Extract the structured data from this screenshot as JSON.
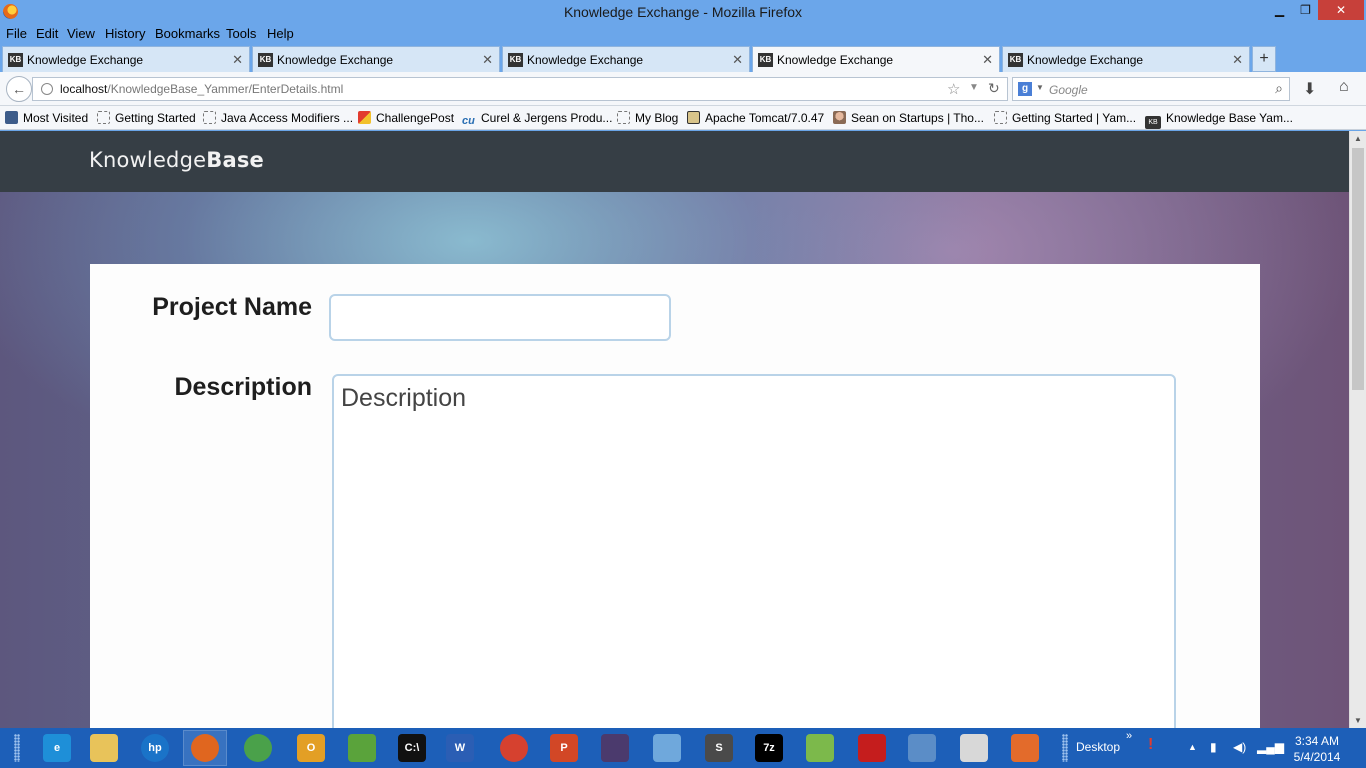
{
  "window": {
    "title": "Knowledge Exchange - Mozilla Firefox",
    "minimize_glyph": "▁",
    "maximize_glyph": "❐",
    "close_glyph": "✕"
  },
  "menu": [
    "File",
    "Edit",
    "View",
    "History",
    "Bookmarks",
    "Tools",
    "Help"
  ],
  "tabs": [
    {
      "label": "Knowledge Exchange",
      "favicon": "KB",
      "active": false
    },
    {
      "label": "Knowledge Exchange",
      "favicon": "KB",
      "active": false
    },
    {
      "label": "Knowledge Exchange",
      "favicon": "KB",
      "active": false
    },
    {
      "label": "Knowledge Exchange",
      "favicon": "KB",
      "active": true
    },
    {
      "label": "Knowledge Exchange",
      "favicon": "KB",
      "active": false
    }
  ],
  "tab_close_glyph": "✕",
  "new_tab_glyph": "+",
  "nav": {
    "back_glyph": "←",
    "url_host": "localhost",
    "url_path": "/KnowledgeBase_Yammer/EnterDetails.html",
    "star_glyph": "☆",
    "dropdown_glyph": "▼",
    "reload_glyph": "↻",
    "search_engine": "g",
    "search_placeholder": "Google",
    "search_glyph": "⌕",
    "download_glyph": "⬇",
    "home_glyph": "⌂"
  },
  "bookmarks": [
    {
      "label": "Most Visited",
      "icon": "bookmark-folder-icon"
    },
    {
      "label": "Getting Started",
      "icon": "page-icon"
    },
    {
      "label": "Java Access Modifiers ...",
      "icon": "page-icon"
    },
    {
      "label": "ChallengePost",
      "icon": "challengepost-icon"
    },
    {
      "label": "Curel & Jergens Produ...",
      "icon": "curel-icon"
    },
    {
      "label": "My Blog",
      "icon": "page-icon"
    },
    {
      "label": "Apache Tomcat/7.0.47",
      "icon": "tomcat-icon"
    },
    {
      "label": "Sean on Startups | Tho...",
      "icon": "avatar-icon"
    },
    {
      "label": "Getting Started | Yam...",
      "icon": "page-icon"
    },
    {
      "label": "Knowledge Base Yam...",
      "icon": "kb-icon"
    }
  ],
  "site": {
    "brand_light": "Knowledge",
    "brand_bold": "Base"
  },
  "form": {
    "project_name_label": "Project Name",
    "project_name_value": "",
    "description_label": "Description",
    "description_placeholder": "Description",
    "description_value": ""
  },
  "taskbar": {
    "apps": [
      {
        "name": "internet-explorer-icon",
        "glyph": "e",
        "color": "#1e8fd8"
      },
      {
        "name": "file-explorer-icon",
        "glyph": "",
        "color": "#e8c35a"
      },
      {
        "name": "hp-icon",
        "glyph": "hp",
        "color": "#1a73c8"
      },
      {
        "name": "firefox-icon",
        "glyph": "",
        "color": "#e0661f"
      },
      {
        "name": "chrome-icon",
        "glyph": "",
        "color": "#4aa14a"
      },
      {
        "name": "outlook-icon",
        "glyph": "O",
        "color": "#e39f25"
      },
      {
        "name": "evernote-icon",
        "glyph": "",
        "color": "#5aa33b"
      },
      {
        "name": "command-prompt-icon",
        "glyph": "C:\\",
        "color": "#111111"
      },
      {
        "name": "word-icon",
        "glyph": "W",
        "color": "#2b5eb4"
      },
      {
        "name": "media-player-icon",
        "glyph": "",
        "color": "#d6412f"
      },
      {
        "name": "powerpoint-icon",
        "glyph": "P",
        "color": "#d24726"
      },
      {
        "name": "eclipse-java-ee-icon",
        "glyph": "",
        "color": "#4b3a6d"
      },
      {
        "name": "remote-desktop-icon",
        "glyph": "",
        "color": "#6fa8dc"
      },
      {
        "name": "sublime-text-icon",
        "glyph": "S",
        "color": "#4a4a4a"
      },
      {
        "name": "7zip-icon",
        "glyph": "7z",
        "color": "#000000"
      },
      {
        "name": "notepad-plus-icon",
        "glyph": "",
        "color": "#7cb94b"
      },
      {
        "name": "acrobat-icon",
        "glyph": "",
        "color": "#c51d1d"
      },
      {
        "name": "paint-icon",
        "glyph": "",
        "color": "#5b8dc7"
      },
      {
        "name": "java-icon",
        "glyph": "",
        "color": "#d8d8d8"
      },
      {
        "name": "install-icon",
        "glyph": "",
        "color": "#e36b2b"
      }
    ],
    "desktop_label": "Desktop",
    "more_glyph": "»",
    "up_arrow_glyph": "▲",
    "time": "3:34 AM",
    "date": "5/4/2014"
  },
  "scroll": {
    "up_glyph": "▲",
    "down_glyph": "▼"
  },
  "colors": {
    "titlebar": "#6ba6ea",
    "site_header": "#363e45",
    "taskbar": "#1d5fb8",
    "close_button": "#c7403a",
    "input_border": "#b9d3e8"
  }
}
